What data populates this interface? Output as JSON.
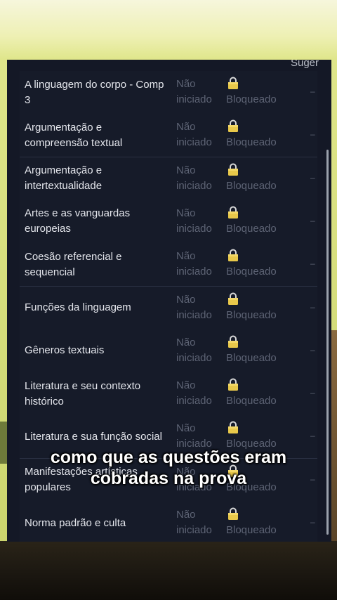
{
  "header": {
    "suggest_label": "Suger"
  },
  "rows": [
    {
      "name": "A linguagem do corpo - Comp 3",
      "status": "Não iniciado",
      "lock_label": "Bloqueado"
    },
    {
      "name": "Argumentação e compreensão textual",
      "status": "Não iniciado",
      "lock_label": "Bloqueado"
    },
    {
      "name": "Argumentação e intertextualidade",
      "status": "Não iniciado",
      "lock_label": "Bloqueado"
    },
    {
      "name": "Artes e as vanguardas europeias",
      "status": "Não iniciado",
      "lock_label": "Bloqueado"
    },
    {
      "name": "Coesão referencial e sequencial",
      "status": "Não iniciado",
      "lock_label": "Bloqueado"
    },
    {
      "name": "Funções da linguagem",
      "status": "Não iniciado",
      "lock_label": "Bloqueado"
    },
    {
      "name": "Gêneros textuais",
      "status": "Não iniciado",
      "lock_label": "Bloqueado"
    },
    {
      "name": "Literatura e seu contexto histórico",
      "status": "Não iniciado",
      "lock_label": "Bloqueado"
    },
    {
      "name": "Literatura e sua função social",
      "status": "Não iniciado",
      "lock_label": "Bloqueado"
    },
    {
      "name": "Manifestações artísticas populares",
      "status": "Não iniciado",
      "lock_label": "Bloqueado"
    },
    {
      "name": "Norma padrão e culta",
      "status": "Não iniciado",
      "lock_label": "Bloqueado"
    }
  ],
  "caption": {
    "line1": "como que as questões eram",
    "line2": "cobradas na prova"
  },
  "colors": {
    "screen_bg": "#141826",
    "text": "#e4e6ec",
    "muted": "#5d6374",
    "lock": "#e8c84a"
  },
  "icons": {
    "lock": "lock-icon",
    "dash": "dash-icon"
  }
}
